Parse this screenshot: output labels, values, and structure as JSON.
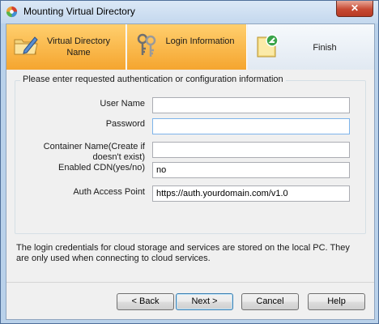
{
  "window": {
    "title": "Mounting Virtual Directory",
    "close_label": "✕"
  },
  "steps": [
    {
      "label": "Virtual Directory Name",
      "icon": "folder-pencil-icon",
      "active": true
    },
    {
      "label": "Login Information",
      "icon": "keys-icon",
      "active": true
    },
    {
      "label": "Finish",
      "icon": "finish-icon",
      "active": false
    }
  ],
  "form": {
    "group_title": "Please enter requested authentication or configuration information",
    "fields": [
      {
        "label": "User Name",
        "value": ""
      },
      {
        "label": "Password",
        "value": ""
      },
      {
        "label": "Container Name(Create if doesn't exist)",
        "value": ""
      },
      {
        "label": "Enabled CDN(yes/no)",
        "value": "no"
      },
      {
        "label": "Auth Access Point",
        "value": "https://auth.yourdomain.com/v1.0"
      }
    ]
  },
  "note": "The login credentials for cloud storage and services are stored on the local PC. They are only used when connecting to cloud services.",
  "buttons": {
    "back": "< Back",
    "next": "Next >",
    "cancel": "Cancel",
    "help": "Help"
  },
  "colors": {
    "step_active": "#f5a52f",
    "step_inactive": "#e1e9f2",
    "title_bar": "#c4d8ee",
    "close": "#c74a33"
  }
}
